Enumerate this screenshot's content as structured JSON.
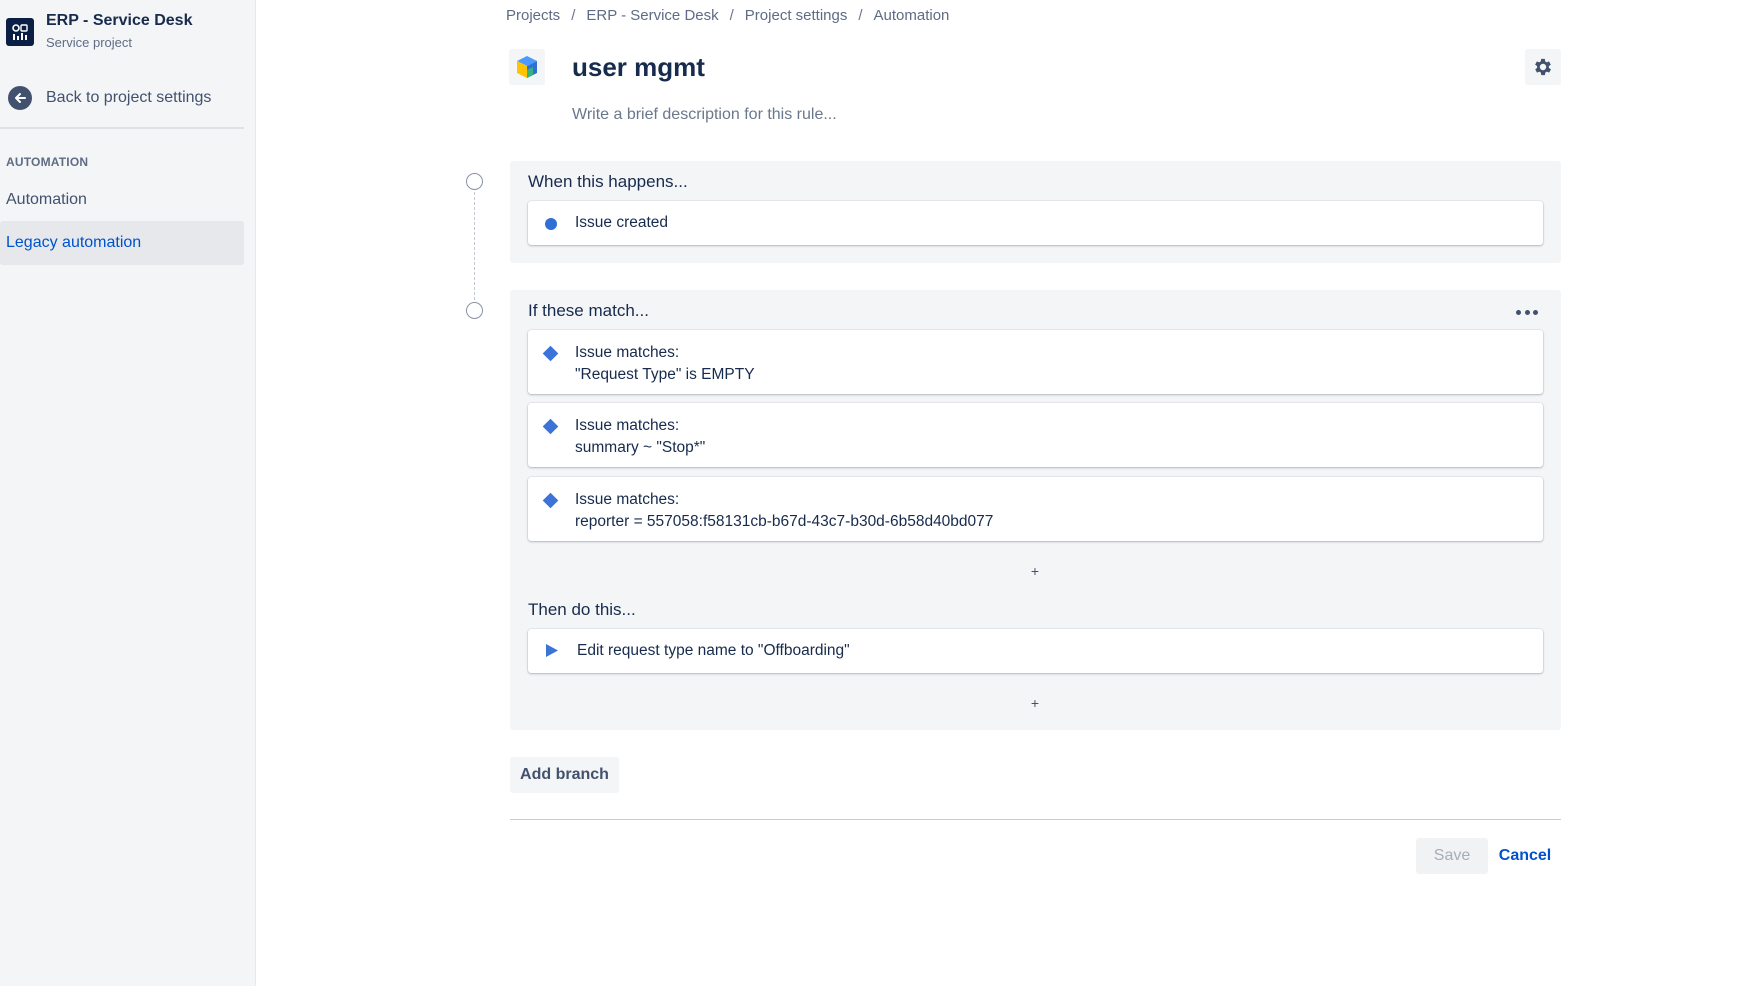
{
  "sidebar": {
    "project_name": "ERP - Service Desk",
    "project_type": "Service project",
    "back_label": "Back to project settings",
    "section_label": "AUTOMATION",
    "items": [
      {
        "label": "Automation",
        "active": false
      },
      {
        "label": "Legacy automation",
        "active": true
      }
    ]
  },
  "breadcrumb": [
    "Projects",
    "ERP - Service Desk",
    "Project settings",
    "Automation"
  ],
  "rule": {
    "title": "user mgmt",
    "description_placeholder": "Write a brief description for this rule..."
  },
  "trigger": {
    "heading": "When this happens...",
    "item": "Issue created"
  },
  "conditions": {
    "heading": "If these match...",
    "items": [
      {
        "line1": "Issue matches:",
        "line2": "\"Request Type\" is EMPTY"
      },
      {
        "line1": "Issue matches:",
        "line2": "summary ~ \"Stop*\""
      },
      {
        "line1": "Issue matches:",
        "line2": "reporter = 557058:f58131cb-b67d-43c7-b30d-6b58d40bd077"
      }
    ],
    "add_symbol": "+"
  },
  "actions": {
    "heading": "Then do this...",
    "item": "Edit request type name to \"Offboarding\"",
    "add_symbol": "+"
  },
  "buttons": {
    "add_branch": "Add branch",
    "save": "Save",
    "cancel": "Cancel"
  },
  "colors": {
    "accent": "#0052cc",
    "component_icon": "#2f6fd6",
    "panel_bg": "#f4f5f7"
  }
}
